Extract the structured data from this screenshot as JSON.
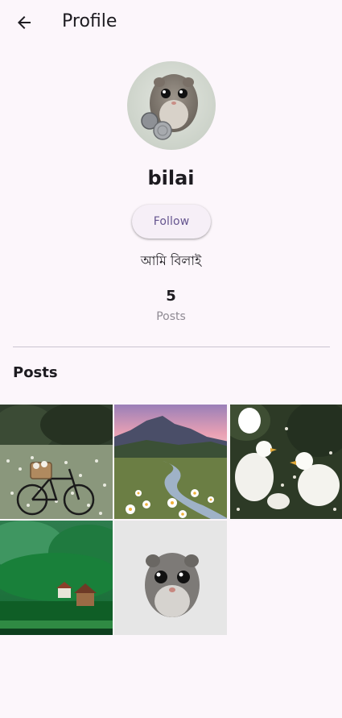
{
  "appbar": {
    "title": "Profile",
    "back_icon": "arrow-back-icon"
  },
  "profile": {
    "username": "bilai",
    "follow_label": "Follow",
    "bio": "আমি বিলাই",
    "posts_count": "5",
    "posts_label": "Posts"
  },
  "posts_section": {
    "title": "Posts",
    "items": [
      {
        "subject": "bicycle in flower meadow"
      },
      {
        "subject": "mountain stream with daisies at sunset"
      },
      {
        "subject": "white ducks among flowers"
      },
      {
        "subject": "green forest with houses"
      },
      {
        "subject": "hamster"
      }
    ]
  },
  "colors": {
    "background": "#fcf6fb",
    "accent": "#65558f",
    "divider": "#cac4d0"
  }
}
